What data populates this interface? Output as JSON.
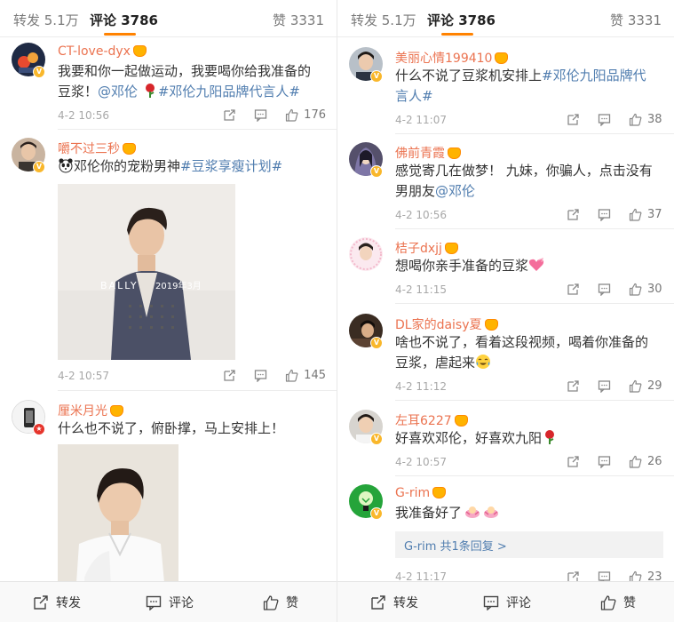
{
  "tabs": {
    "repost": "转发 5.1万",
    "comment": "评论 3786",
    "like": "赞 3331"
  },
  "bottom_bar": {
    "repost": "转发",
    "comment": "评论",
    "like": "赞"
  },
  "left": {
    "comments": [
      {
        "username": "CT-love-dyx",
        "text_parts": [
          "我要和你一起做运动，我要喝你给我准备的豆浆！",
          "@邓伦",
          " ",
          "#邓伦九阳品牌代言人#"
        ],
        "time": "4-2 10:56",
        "likes": "176"
      },
      {
        "username": "嚼不过三秒",
        "text_parts": [
          "邓伦你的宠粉男神",
          "#豆浆享瘦计划#"
        ],
        "photo_text": {
          "brand": "BALLY",
          "date": "2019年3月"
        },
        "time": "4-2 10:57",
        "likes": "145"
      },
      {
        "username": "厘米月光",
        "text": "什么也不说了，俯卧撑，马上安排上！"
      }
    ]
  },
  "right": {
    "comments": [
      {
        "username": "美丽心情199410",
        "text_parts": [
          "什么不说了豆浆机安排上",
          "#邓伦九阳品牌代言人#"
        ],
        "time": "4-2 11:07",
        "likes": "38"
      },
      {
        "username": "佛前青霞",
        "text_parts": [
          "感觉寄几在做梦！ 九妹，你骗人，点击没有男朋友",
          "@邓伦"
        ],
        "time": "4-2 10:56",
        "likes": "37"
      },
      {
        "username": "桔子dxjj",
        "text": "想喝你亲手准备的豆浆",
        "time": "4-2 11:15",
        "likes": "30"
      },
      {
        "username": "DL家的daisy夏",
        "text": "啥也不说了，看着这段视频，喝着你准备的豆浆，虐起来",
        "time": "4-2 11:12",
        "likes": "29"
      },
      {
        "username": "左耳6227",
        "text": "好喜欢邓伦，好喜欢九阳",
        "time": "4-2 10:57",
        "likes": "26"
      },
      {
        "username": "G-rim",
        "text": "我准备好了",
        "reply_summary": "G-rim  共1条回复 >",
        "time": "4-2 11:17",
        "likes": "23"
      }
    ]
  },
  "icons": {
    "badge_vip": "crown-icon",
    "share": "share-icon",
    "comment": "comment-icon",
    "like": "thumbs-up-icon"
  },
  "colors": {
    "username": "#eb7350",
    "link": "#507daf",
    "accent": "#ff8200",
    "meta": "#a8a8a8"
  }
}
